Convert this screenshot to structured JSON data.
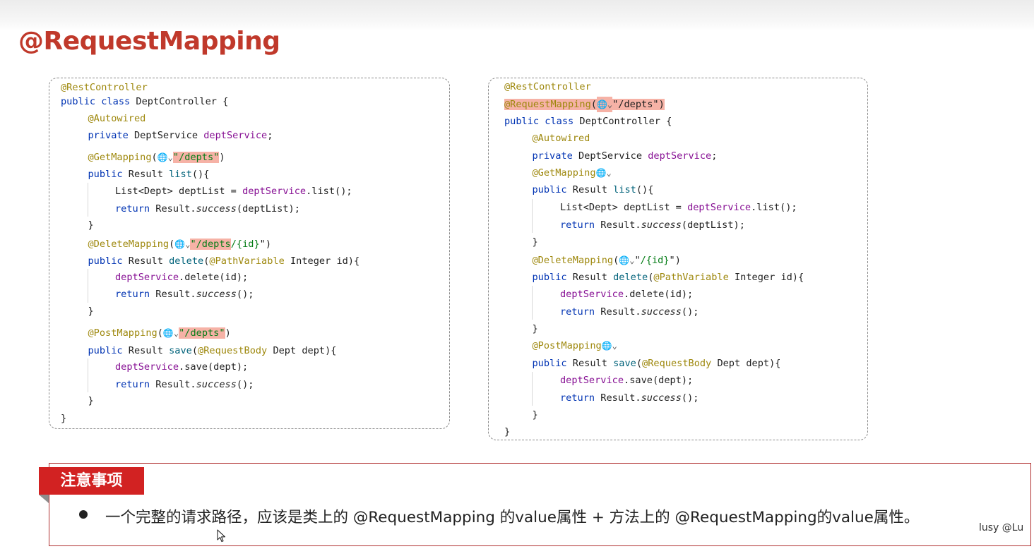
{
  "slide": {
    "title": "@RequestMapping",
    "left_code": [
      {
        "i": 0,
        "t": [
          [
            "ann",
            "@RestController"
          ]
        ]
      },
      {
        "i": 0,
        "t": [
          [
            "kw",
            "public class "
          ],
          [
            "",
            "DeptController {"
          ]
        ]
      },
      {
        "i": 1,
        "t": [
          [
            "ann",
            "@Autowired"
          ]
        ]
      },
      {
        "i": 1,
        "t": [
          [
            "kw",
            "private "
          ],
          [
            "",
            "DeptService "
          ],
          [
            "fld",
            "deptService"
          ],
          [
            "",
            ";"
          ]
        ]
      },
      {
        "i": 1,
        "t": [
          [
            "ann",
            "@GetMapping"
          ],
          [
            "",
            "("
          ],
          [
            "globe",
            "🌐⌄"
          ],
          [
            "strhl",
            "\"/depts\""
          ],
          [
            "",
            ")"
          ]
        ]
      },
      {
        "i": 1,
        "t": [
          [
            "kw",
            "public "
          ],
          [
            "",
            "Result "
          ],
          [
            "mth",
            "list"
          ],
          [
            "",
            "(){"
          ]
        ]
      },
      {
        "i": 2,
        "t": [
          [
            "",
            "List<Dept> deptList = "
          ],
          [
            "fld",
            "deptService"
          ],
          [
            "",
            ".list();"
          ]
        ]
      },
      {
        "i": 2,
        "t": [
          [
            "kw",
            "return "
          ],
          [
            "",
            "Result."
          ],
          [
            "it",
            "success"
          ],
          [
            "",
            "(deptList);"
          ]
        ]
      },
      {
        "i": 1,
        "t": [
          [
            "",
            "}"
          ]
        ]
      },
      {
        "i": 1,
        "t": [
          [
            "ann",
            "@DeleteMapping"
          ],
          [
            "",
            "("
          ],
          [
            "globe",
            "🌐⌄"
          ],
          [
            "strhl",
            "\"/depts"
          ],
          [
            "str",
            "/{id}"
          ],
          [
            "",
            "\")"
          ]
        ]
      },
      {
        "i": 1,
        "t": [
          [
            "kw",
            "public "
          ],
          [
            "",
            "Result "
          ],
          [
            "mth",
            "delete"
          ],
          [
            "",
            "("
          ],
          [
            "ann",
            "@PathVariable "
          ],
          [
            "",
            "Integer id){"
          ]
        ]
      },
      {
        "i": 2,
        "t": [
          [
            "fld",
            "deptService"
          ],
          [
            "",
            ".delete(id);"
          ]
        ]
      },
      {
        "i": 2,
        "t": [
          [
            "kw",
            "return "
          ],
          [
            "",
            "Result."
          ],
          [
            "it",
            "success"
          ],
          [
            "",
            "();"
          ]
        ]
      },
      {
        "i": 1,
        "t": [
          [
            "",
            "}"
          ]
        ]
      },
      {
        "i": 1,
        "t": [
          [
            "ann",
            "@PostMapping"
          ],
          [
            "",
            "("
          ],
          [
            "globe",
            "🌐⌄"
          ],
          [
            "strhl",
            "\"/depts\""
          ],
          [
            "",
            ")"
          ]
        ]
      },
      {
        "i": 1,
        "t": [
          [
            "kw",
            "public "
          ],
          [
            "",
            "Result "
          ],
          [
            "mth",
            "save"
          ],
          [
            "",
            "("
          ],
          [
            "ann",
            "@RequestBody "
          ],
          [
            "",
            "Dept dept){"
          ]
        ]
      },
      {
        "i": 2,
        "t": [
          [
            "fld",
            "deptService"
          ],
          [
            "",
            ".save(dept);"
          ]
        ]
      },
      {
        "i": 2,
        "t": [
          [
            "kw",
            "return "
          ],
          [
            "",
            "Result."
          ],
          [
            "it",
            "success"
          ],
          [
            "",
            "();"
          ]
        ]
      },
      {
        "i": 1,
        "t": [
          [
            "",
            "}"
          ]
        ]
      },
      {
        "i": 0,
        "t": [
          [
            "",
            "}"
          ]
        ]
      }
    ],
    "right_code": [
      {
        "i": 0,
        "t": [
          [
            "ann",
            "@RestController"
          ]
        ]
      },
      {
        "i": 0,
        "t": [
          [
            "annhl",
            "@RequestMapping"
          ],
          [
            "hl",
            "("
          ],
          [
            "globehl",
            "🌐⌄"
          ],
          [
            "hl",
            "\"/depts\")"
          ]
        ]
      },
      {
        "i": 0,
        "t": [
          [
            "kw",
            "public class "
          ],
          [
            "",
            "DeptController {"
          ]
        ]
      },
      {
        "i": 1,
        "t": [
          [
            "ann",
            "@Autowired"
          ]
        ]
      },
      {
        "i": 1,
        "t": [
          [
            "kw",
            "private "
          ],
          [
            "",
            "DeptService "
          ],
          [
            "fld",
            "deptService"
          ],
          [
            "",
            ";"
          ]
        ]
      },
      {
        "i": 1,
        "t": [
          [
            "ann",
            "@GetMapping"
          ],
          [
            "globe",
            "🌐⌄"
          ]
        ]
      },
      {
        "i": 1,
        "t": [
          [
            "kw",
            "public "
          ],
          [
            "",
            "Result "
          ],
          [
            "mth",
            "list"
          ],
          [
            "",
            "(){"
          ]
        ]
      },
      {
        "i": 2,
        "t": [
          [
            "",
            "List<Dept> deptList = "
          ],
          [
            "fld",
            "deptService"
          ],
          [
            "",
            ".list();"
          ]
        ]
      },
      {
        "i": 2,
        "t": [
          [
            "kw",
            "return "
          ],
          [
            "",
            "Result."
          ],
          [
            "it",
            "success"
          ],
          [
            "",
            "(deptList);"
          ]
        ]
      },
      {
        "i": 1,
        "t": [
          [
            "",
            "}"
          ]
        ]
      },
      {
        "i": 1,
        "t": [
          [
            "ann",
            "@DeleteMapping"
          ],
          [
            "",
            "("
          ],
          [
            "globe",
            "🌐⌄"
          ],
          [
            "",
            "\""
          ],
          [
            "str",
            "/{id}"
          ],
          [
            "",
            "\")"
          ]
        ]
      },
      {
        "i": 1,
        "t": [
          [
            "kw",
            "public "
          ],
          [
            "",
            "Result "
          ],
          [
            "mth",
            "delete"
          ],
          [
            "",
            "("
          ],
          [
            "ann",
            "@PathVariable "
          ],
          [
            "",
            "Integer id){"
          ]
        ]
      },
      {
        "i": 2,
        "t": [
          [
            "fld",
            "deptService"
          ],
          [
            "",
            ".delete(id);"
          ]
        ]
      },
      {
        "i": 2,
        "t": [
          [
            "kw",
            "return "
          ],
          [
            "",
            "Result."
          ],
          [
            "it",
            "success"
          ],
          [
            "",
            "();"
          ]
        ]
      },
      {
        "i": 1,
        "t": [
          [
            "",
            "}"
          ]
        ]
      },
      {
        "i": 1,
        "t": [
          [
            "ann",
            "@PostMapping"
          ],
          [
            "globe",
            "🌐⌄"
          ]
        ]
      },
      {
        "i": 1,
        "t": [
          [
            "kw",
            "public "
          ],
          [
            "",
            "Result "
          ],
          [
            "mth",
            "save"
          ],
          [
            "",
            "("
          ],
          [
            "ann",
            "@RequestBody "
          ],
          [
            "",
            "Dept dept){"
          ]
        ]
      },
      {
        "i": 2,
        "t": [
          [
            "fld",
            "deptService"
          ],
          [
            "",
            ".save(dept);"
          ]
        ]
      },
      {
        "i": 2,
        "t": [
          [
            "kw",
            "return "
          ],
          [
            "",
            "Result."
          ],
          [
            "it",
            "success"
          ],
          [
            "",
            "();"
          ]
        ]
      },
      {
        "i": 1,
        "t": [
          [
            "",
            "}"
          ]
        ]
      },
      {
        "i": 0,
        "t": [
          [
            "",
            "}"
          ]
        ]
      }
    ],
    "notes": {
      "tag": "注意事项",
      "text": "一个完整的请求路径，应该是类上的 @RequestMapping 的value属性 + 方法上的 @RequestMapping的value属性。"
    },
    "watermark": "lusy @Lu"
  }
}
